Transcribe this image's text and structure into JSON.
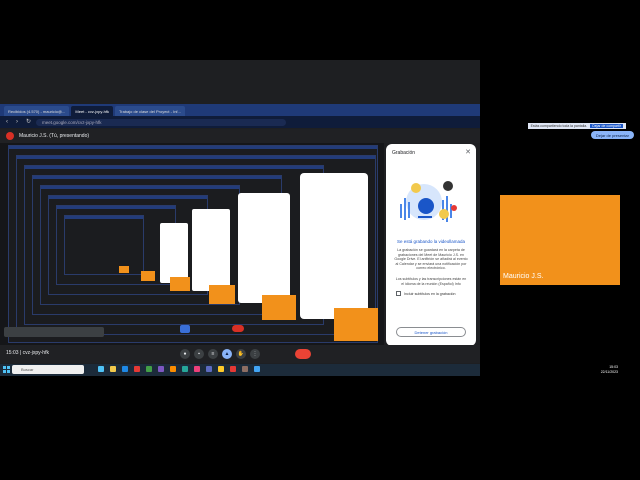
{
  "browser": {
    "tabs": [
      "Recibidos (4.570) - mauricio@...",
      "Meet - cvz-jxpy-hfk",
      "Trabajo de clase del Proyect - Inf..."
    ],
    "url": "meet.google.com/cvz-jxpy-hfk"
  },
  "share_notice": {
    "text": "Estás compartiendo toda la pantalla.",
    "stop_label": "Dejar de compartir"
  },
  "meet_header": {
    "presenter_label": "Mauricio J.S. (Tú, presentando)",
    "stop_presenting": "Dejar de presentar"
  },
  "dialog": {
    "title": "Grabación",
    "close_icon": "close-icon",
    "heading": "Se está grabando la videollamada",
    "body": "La grabación se guardará en la carpeta de grabaciones del Meet de Mauricio J.S. en Google Drive. El anfitrión se añadirá al evento al Calendar y se enviará una notificación por correo electrónico.",
    "body2": "Los subtítulos y las transcripciones están en el idioma de la reunión (Español) Info",
    "checkbox_label": "Incluir subtítulos en la grabación",
    "stop_button": "Detener grabación"
  },
  "meet_bottom": {
    "time_code": "15:03 | cvz-jxpy-hfk"
  },
  "taskbar": {
    "search_placeholder": "Buscar",
    "clock_time": "15:03",
    "clock_date": "22/11/2023",
    "temp": "ENG"
  },
  "participant": {
    "name": "Mauricio J.S."
  },
  "colors": {
    "accent_orange": "#f2911b",
    "record_red": "#d93025",
    "browser_blue": "#1f3a78"
  }
}
